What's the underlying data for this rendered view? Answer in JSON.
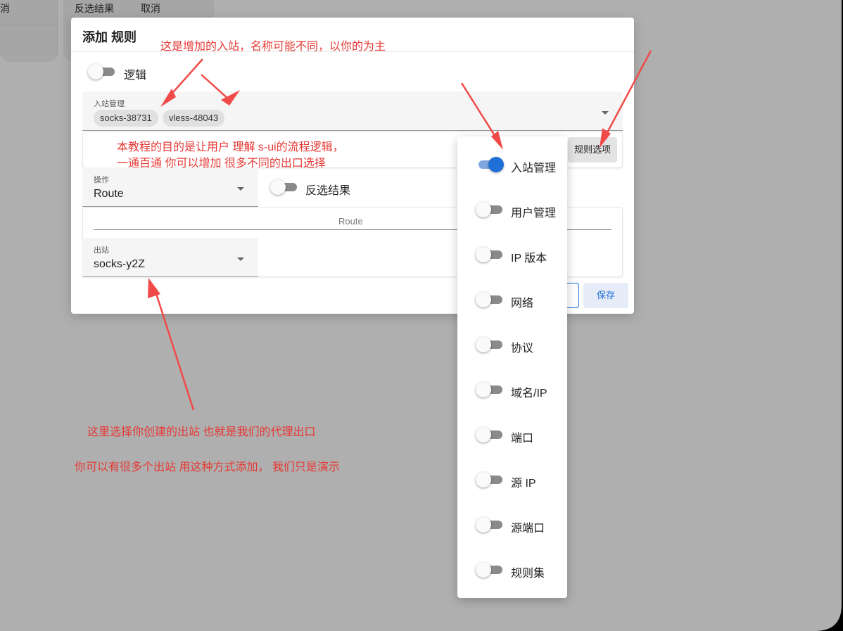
{
  "background": {
    "left_card_text": "消",
    "right_card_invert": "反选结果",
    "right_card_cancel": "取消"
  },
  "dialog": {
    "title": "添加 规则",
    "logic_label": "逻辑",
    "inbound": {
      "label": "入站管理",
      "chips": [
        "socks-38731",
        "vless-48043"
      ]
    },
    "rule_options_button": "规则选项",
    "action": {
      "label": "操作",
      "value": "Route"
    },
    "invert_label": "反选结果",
    "route_section_label": "Route",
    "outbound": {
      "label": "出站",
      "value": "socks-y2Z"
    },
    "save_button": "保存"
  },
  "menu": {
    "items": [
      {
        "label": "入站管理",
        "on": true
      },
      {
        "label": "用户管理",
        "on": false
      },
      {
        "label": "IP 版本",
        "on": false
      },
      {
        "label": "网络",
        "on": false
      },
      {
        "label": "协议",
        "on": false
      },
      {
        "label": "域名/IP",
        "on": false
      },
      {
        "label": "端口",
        "on": false
      },
      {
        "label": "源 IP",
        "on": false
      },
      {
        "label": "源端口",
        "on": false
      },
      {
        "label": "规则集",
        "on": false
      }
    ]
  },
  "annotations": {
    "inbound_note": "这是增加的入站，名称可能不同，以你的为主",
    "tutorial_line1": "本教程的目的是让用户 理解 s-ui的流程逻辑，",
    "tutorial_line2": "一通百通 你可以增加 很多不同的出口选择",
    "outbound_note": "这里选择你创建的出站 也就是我们的代理出口",
    "multi_note": "你可以有很多个出站 用这种方式添加， 我们只是演示"
  },
  "colors": {
    "accent": "#1f6fd6",
    "annotation": "#e53935",
    "backdrop": "#afafaf"
  }
}
